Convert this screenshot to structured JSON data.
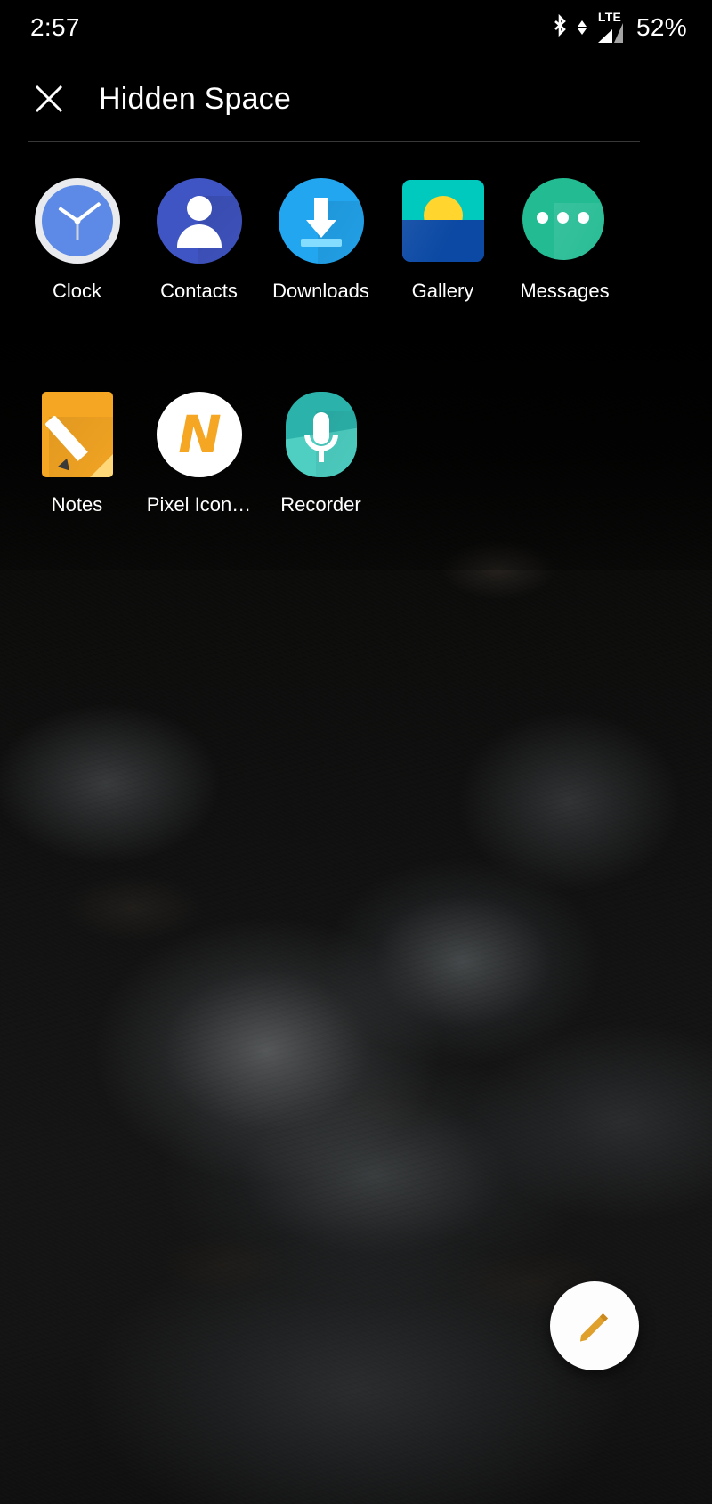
{
  "status_bar": {
    "time": "2:57",
    "battery_percent": "52%",
    "network_type": "LTE",
    "icons": [
      "bluetooth-icon",
      "data-transfer-arrows-icon",
      "cellular-signal-icon"
    ]
  },
  "header": {
    "close_label": "×",
    "title": "Hidden Space"
  },
  "apps": [
    {
      "label": "Clock",
      "icon": "clock-icon"
    },
    {
      "label": "Contacts",
      "icon": "contacts-icon"
    },
    {
      "label": "Downloads",
      "icon": "downloads-icon"
    },
    {
      "label": "Gallery",
      "icon": "gallery-icon"
    },
    {
      "label": "Messages",
      "icon": "messages-icon"
    },
    {
      "label": "Notes",
      "icon": "notes-icon"
    },
    {
      "label": "Pixel Icon…",
      "icon": "pixel-icon-pack-icon"
    },
    {
      "label": "Recorder",
      "icon": "recorder-icon"
    }
  ],
  "fab": {
    "icon": "edit-pencil-icon",
    "accent_color": "#e0a02c"
  },
  "colors": {
    "background": "#000000",
    "text": "#ffffff",
    "divider": "rgba(255,255,255,0.22)",
    "clock_face": "#5c8ae6",
    "contacts_blue": "#4055c4",
    "downloads_blue": "#23a6f0",
    "gallery_sky": "#00c9bd",
    "gallery_sun": "#ffd52e",
    "gallery_water": "#0b49a4",
    "messages_teal": "#22bb92",
    "notes_orange": "#f5a623",
    "recorder_teal": "#2bb3ab"
  }
}
